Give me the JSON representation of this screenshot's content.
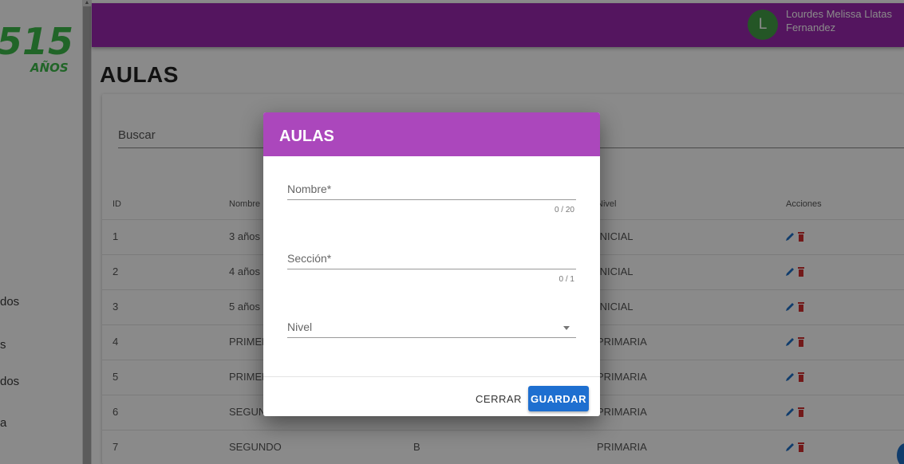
{
  "sidebar": {
    "logo_text": "15",
    "logo_sub": "AÑOS",
    "logo_prefix": "5",
    "items": [
      "dos",
      "s",
      "dos",
      "a"
    ]
  },
  "user": {
    "avatar_initial": "L",
    "name": "Lourdes Melissa Llatas Fernandez"
  },
  "page": {
    "title": "AULAS",
    "search_label": "Buscar"
  },
  "table": {
    "headers": {
      "id": "ID",
      "nombre": "Nombre",
      "nivel": "Nivel",
      "acciones": "Acciones"
    },
    "rows": [
      {
        "id": "1",
        "nombre": "3 años",
        "seccion": "",
        "nivel": "INICIAL"
      },
      {
        "id": "2",
        "nombre": "4 años",
        "seccion": "",
        "nivel": "INICIAL"
      },
      {
        "id": "3",
        "nombre": "5 años",
        "seccion": "",
        "nivel": "INICIAL"
      },
      {
        "id": "4",
        "nombre": "PRIMER",
        "seccion": "",
        "nivel": "PRIMARIA"
      },
      {
        "id": "5",
        "nombre": "PRIMER",
        "seccion": "",
        "nivel": "PRIMARIA"
      },
      {
        "id": "6",
        "nombre": "SEGUND",
        "seccion": "",
        "nivel": "PRIMARIA"
      },
      {
        "id": "7",
        "nombre": "SEGUNDO",
        "seccion": "B",
        "nivel": "PRIMARIA"
      }
    ],
    "edit_icon": "pencil-icon",
    "delete_icon": "trash-icon"
  },
  "dialog": {
    "title": "AULAS",
    "nombre_label": "Nombre*",
    "nombre_value": "",
    "nombre_counter": "0 / 20",
    "seccion_label": "Sección*",
    "seccion_value": "",
    "seccion_counter": "0 / 1",
    "nivel_label": "Nivel",
    "cerrar_label": "CERRAR",
    "guardar_label": "GUARDAR"
  },
  "colors": {
    "topbar": "#9c27b0",
    "dialog_header": "#ab47bc",
    "primary_button": "#1e6fd0",
    "avatar": "#43a047",
    "edit_icon": "#1e70c8",
    "delete_icon": "#d32f2f"
  }
}
